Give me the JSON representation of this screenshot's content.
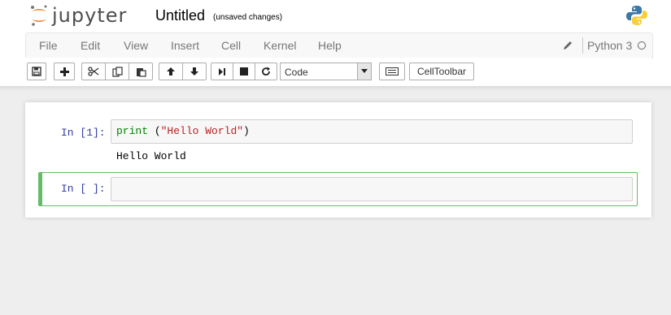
{
  "header": {
    "logo_text": "jupyter",
    "notebook_title": "Untitled",
    "autosave_status": "(unsaved changes)"
  },
  "menubar": {
    "items": [
      "File",
      "Edit",
      "View",
      "Insert",
      "Cell",
      "Kernel",
      "Help"
    ],
    "kernel_name": "Python 3"
  },
  "toolbar": {
    "icons": [
      "save-icon",
      "plus-icon",
      "cut-icon",
      "copy-icon",
      "paste-icon",
      "arrow-up-icon",
      "arrow-down-icon",
      "run-icon",
      "stop-icon",
      "restart-icon",
      "keyboard-icon"
    ],
    "cell_type": "Code",
    "celltoolbar_label": "CellToolbar"
  },
  "cells": [
    {
      "prompt": "In [1]:",
      "code_func": "print",
      "code_open": " (",
      "code_string": "\"Hello World\"",
      "code_close": ")",
      "output": "Hello World"
    },
    {
      "prompt": "In [ ]:",
      "code": ""
    }
  ],
  "colors": {
    "accent_orange": "#f37726",
    "selected_cell_border": "#66bb6a",
    "prompt_color": "#303f9f",
    "keyword_green": "#008000",
    "string_red": "#ba2121"
  }
}
